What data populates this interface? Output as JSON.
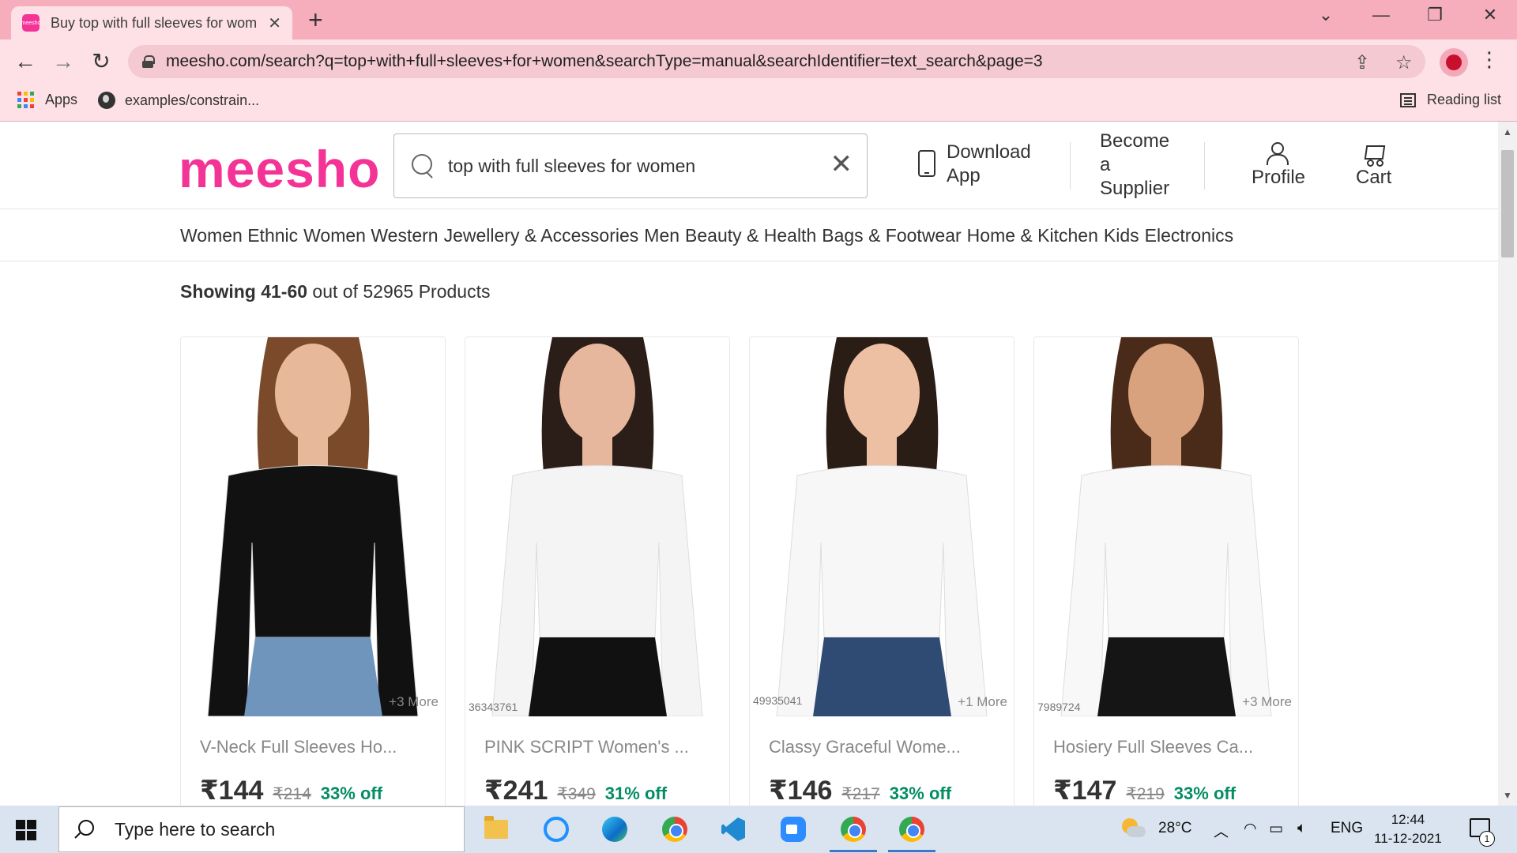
{
  "browser": {
    "tab_title": "Buy top with full sleeves for wom",
    "favicon_text": "meesho",
    "url": "meesho.com/search?q=top+with+full+sleeves+for+women&searchType=manual&searchIdentifier=text_search&page=3",
    "bookmarks": [
      {
        "label": "Apps",
        "icon": "apps-grid-icon"
      },
      {
        "label": "examples/constrain...",
        "icon": "globe-icon"
      }
    ],
    "reading_list": "Reading list",
    "accent_color": "#f6aebd"
  },
  "header": {
    "logo": "meesho",
    "logo_color": "#f43397",
    "search_value": "top with full sleeves for women",
    "download_app": [
      "Download",
      "App"
    ],
    "become_supplier": [
      "Become",
      "a",
      "Supplier"
    ],
    "profile": "Profile",
    "cart": "Cart"
  },
  "categories": [
    "Women Ethnic",
    "Women Western",
    "Jewellery & Accessories",
    "Men",
    "Beauty & Health",
    "Bags & Footwear",
    "Home & Kitchen",
    "Kids",
    "Electronics"
  ],
  "results": {
    "range": "Showing 41-60",
    "rest": " out of 52965 Products"
  },
  "products": [
    {
      "title": "V-Neck Full Sleeves Ho...",
      "price": "₹144",
      "mrp": "₹214",
      "discount": "33% off",
      "more": "+3 More",
      "code": "",
      "top_color": "#111111",
      "skin": "#e8b89a",
      "hair": "#7a4a2a",
      "bottom": "#6f95bd"
    },
    {
      "title": "PINK SCRIPT Women's ...",
      "price": "₹241",
      "mrp": "₹349",
      "discount": "31% off",
      "more": "",
      "code": "36343761",
      "top_color": "#f4f4f4",
      "skin": "#e6b79c",
      "hair": "#2b1d17",
      "bottom": "#111111"
    },
    {
      "title": "Classy Graceful Wome...",
      "price": "₹146",
      "mrp": "₹217",
      "discount": "33% off",
      "more": "+1 More",
      "code": "49935041",
      "top_color": "#f7f7f7",
      "skin": "#eec0a3",
      "hair": "#2a1d16",
      "bottom": "#2f4a73"
    },
    {
      "title": "Hosiery Full Sleeves Ca...",
      "price": "₹147",
      "mrp": "₹219",
      "discount": "33% off",
      "more": "+3 More",
      "code": "7989724",
      "top_color": "#f8f8f8",
      "skin": "#d9a27f",
      "hair": "#4a2a18",
      "bottom": "#151515"
    }
  ],
  "taskbar": {
    "search_placeholder": "Type here to search",
    "weather": "28°C",
    "language": "ENG",
    "time": "12:44",
    "date": "11-12-2021",
    "notifications": "1"
  }
}
